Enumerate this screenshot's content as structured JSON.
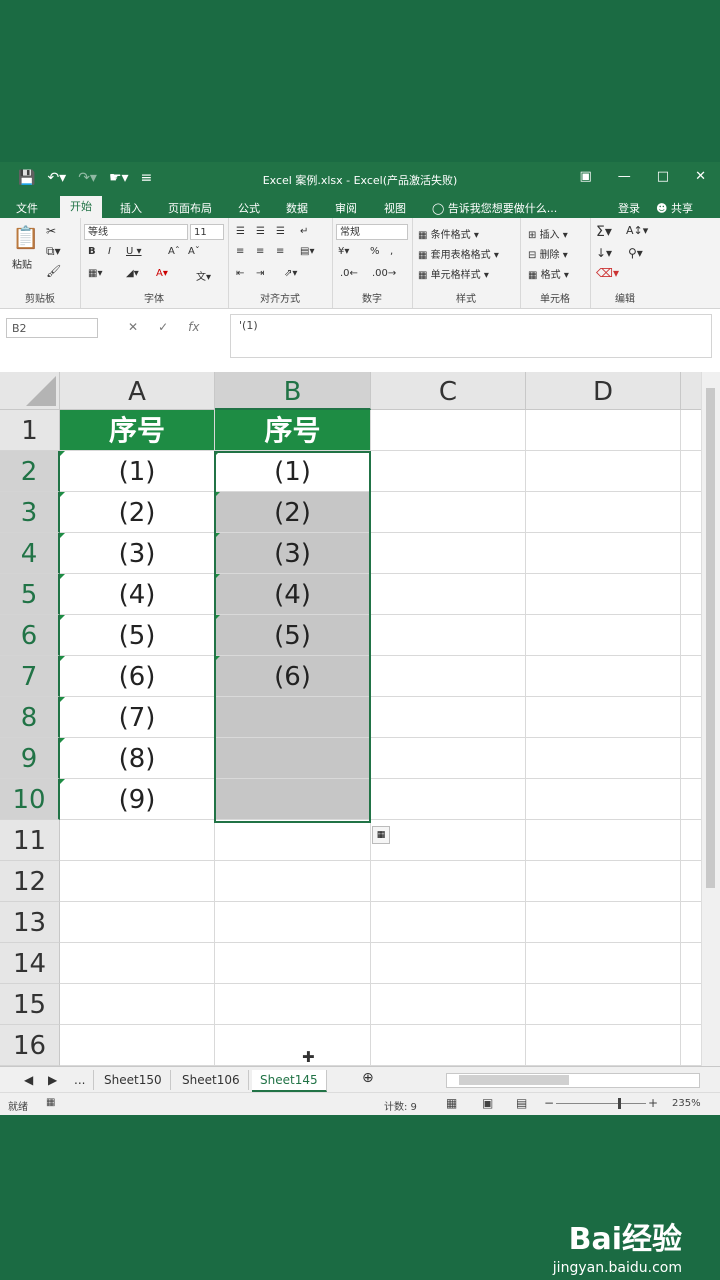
{
  "titlebar": {
    "title": "Excel 案例.xlsx - Excel(产品激活失败)",
    "qat": [
      "save-icon",
      "undo-icon",
      "redo-icon",
      "touch-mode-icon",
      "customize-icon"
    ]
  },
  "tabs": {
    "file": "文件",
    "home": "开始",
    "insert": "插入",
    "page_layout": "页面布局",
    "formulas": "公式",
    "data": "数据",
    "review": "审阅",
    "view": "视图",
    "tell_me": "告诉我您想要做什么...",
    "login": "登录",
    "share": "共享"
  },
  "ribbon": {
    "clipboard": {
      "label": "剪贴板",
      "paste": "粘贴"
    },
    "font": {
      "label": "字体",
      "name": "等线",
      "size": "11"
    },
    "alignment": {
      "label": "对齐方式"
    },
    "number": {
      "label": "数字",
      "format": "常规"
    },
    "styles": {
      "label": "样式",
      "conditional": "条件格式",
      "table": "套用表格格式",
      "cell": "单元格样式"
    },
    "cells": {
      "label": "单元格",
      "insert": "插入",
      "delete": "删除",
      "format": "格式"
    },
    "editing": {
      "label": "编辑"
    }
  },
  "formula_bar": {
    "name_box": "B2",
    "content": "'(1)"
  },
  "sheet": {
    "columns": [
      "A",
      "B",
      "C",
      "D"
    ],
    "rows": [
      "1",
      "2",
      "3",
      "4",
      "5",
      "6",
      "7",
      "8",
      "9",
      "10",
      "11",
      "12",
      "13",
      "14",
      "15",
      "16"
    ],
    "A": [
      "序号",
      "(1)",
      "(2)",
      "(3)",
      "(4)",
      "(5)",
      "(6)",
      "(7)",
      "(8)",
      "(9)",
      "",
      "",
      "",
      "",
      "",
      ""
    ],
    "B": [
      "序号",
      "(1)",
      "(2)",
      "(3)",
      "(4)",
      "(5)",
      "(6)",
      "",
      "",
      "",
      "",
      "",
      "",
      "",
      "",
      ""
    ],
    "selection": "B2:B10"
  },
  "sheet_tabs": {
    "ellipsis": "...",
    "tabs": [
      "Sheet150",
      "Sheet106",
      "Sheet145"
    ],
    "active": "Sheet145"
  },
  "status": {
    "mode": "就绪",
    "count": "计数: 9",
    "zoom": "235%"
  },
  "watermark": {
    "brand": "Bai经验",
    "url": "jingyan.baidu.com"
  },
  "colors": {
    "excel_green": "#217346",
    "header_fill": "#1e8c44",
    "selection_fill": "#c6c6c6"
  }
}
